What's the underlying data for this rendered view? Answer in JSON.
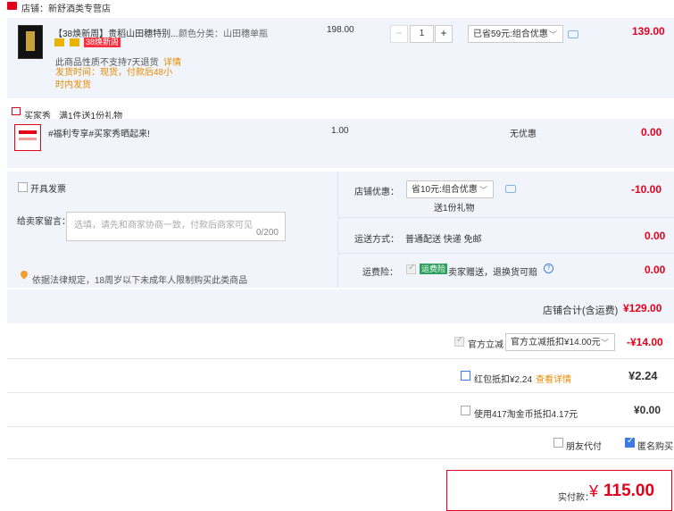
{
  "shop": {
    "label": "店铺：新舒酒类专营店"
  },
  "item1": {
    "title": "【38焕新周】贵稻山田穗特别...",
    "badge": "38焕新周",
    "attr": "颜色分类：山田穗单瓶",
    "price": "198.00",
    "qty": "1",
    "promo": "已省59元:组合优惠",
    "total": "139.00",
    "note1": "此商品性质不支持7天退货",
    "note1_link": "详情",
    "note2": "发货时间：现货，付款后48小时内发货"
  },
  "gift": {
    "header": "买家秀",
    "header_desc": "满1件送1份礼物",
    "title": "#福利专享#买家秀晒起来!",
    "price": "1.00",
    "discount": "无优惠",
    "total": "0.00"
  },
  "options": {
    "invoice_label": "开具发票",
    "message_label": "给卖家留言：",
    "message_placeholder": "选填，请先和商家协商一致，付款后商家可见",
    "message_counter": "0/200",
    "legal_notice": "依据法律规定，18周岁以下未成年人限制购买此类商品",
    "shop_discount_label": "店铺优惠：",
    "shop_discount_value": "省10元:组合优惠",
    "shop_discount_sub": "送1份礼物",
    "shop_discount_amount": "-10.00",
    "delivery_label": "运送方式：",
    "delivery_value": "普通配送 快递 免邮",
    "delivery_amount": "0.00",
    "insurance_label": "运费险：",
    "insurance_badge": "运费险",
    "insurance_value": "卖家赠送，退换货可赔",
    "insurance_amount": "0.00",
    "subtotal_label": "店铺合计(含运费)",
    "subtotal_value": "¥129.00"
  },
  "payment": {
    "official_label": "官方立减",
    "official_select": "官方立减抵扣¥14.00元",
    "official_amount": "-¥14.00",
    "redpacket_label": "红包抵扣¥2.24",
    "redpacket_link": "查看详情",
    "redpacket_amount": "¥2.24",
    "coins_label": "使用417淘金币抵扣4.17元",
    "coins_amount": "¥0.00",
    "friend_pay": "朋友代付",
    "anonymous": "匿名购买"
  },
  "footer": {
    "pay_label": "实付款：",
    "currency": "¥",
    "pay_amount": "115.00"
  },
  "colors": {
    "accent": "#e4001b",
    "panel": "#f1f5fb",
    "link": "#e68a00"
  }
}
